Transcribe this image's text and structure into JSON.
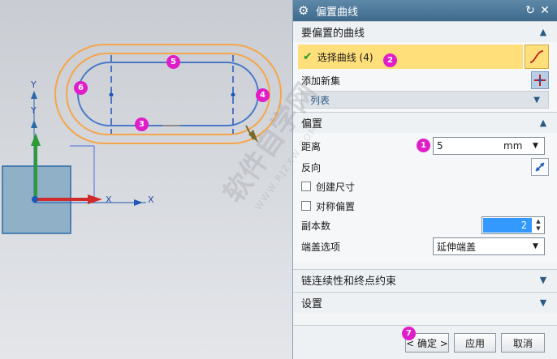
{
  "dialog": {
    "title": "偏置曲线",
    "reset_icon": "reset-icon",
    "close_icon": "close-icon"
  },
  "curves_section": {
    "title": "要偏置的曲线",
    "select_label": "选择曲线 (4)",
    "add_set_label": "添加新集",
    "list_label": "列表"
  },
  "offset_section": {
    "title": "偏置",
    "distance_label": "距离",
    "distance_value": "5",
    "distance_unit": "mm",
    "reverse_label": "反向",
    "create_dim_label": "创建尺寸",
    "symmetric_label": "对称偏置",
    "copies_label": "副本数",
    "copies_value": "2",
    "cap_label": "端盖选项",
    "cap_value": "延伸端盖"
  },
  "chain_section": {
    "title": "链连续性和终点约束"
  },
  "settings_section": {
    "title": "设置"
  },
  "footer": {
    "ok_label": "< 确定 >",
    "apply_label": "应用",
    "cancel_label": "取消"
  },
  "axes": {
    "y_label": "Y",
    "x_label": "X",
    "y2_label": "Y",
    "x2_label": "X"
  },
  "badges": [
    "1",
    "2",
    "3",
    "4",
    "5",
    "6",
    "7"
  ],
  "watermark": {
    "big": "软件自学网",
    "small": "WWW.RJZXW.COM"
  },
  "colors": {
    "accent": "#3e6a8c",
    "selection": "#ffdf7a",
    "badge": "#e01ec8",
    "curve": "#f5a54a"
  }
}
